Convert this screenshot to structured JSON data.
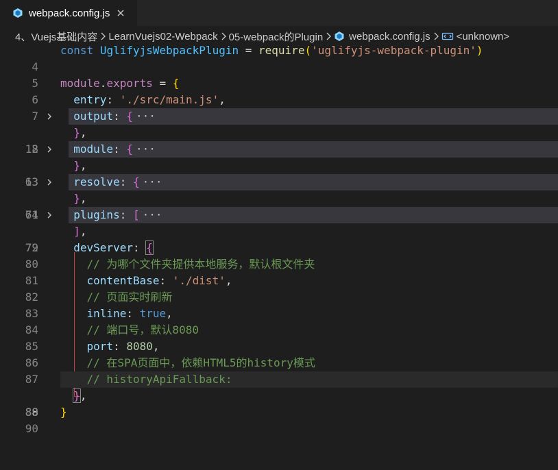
{
  "tab": {
    "label": "webpack.config.js",
    "icon": "webpack-file-icon",
    "close_icon": "close-icon"
  },
  "breadcrumb": {
    "items": [
      "4、Vuejs基础内容",
      "LearnVuejs02-Webpack",
      "05-webpack的Plugin",
      "webpack.config.js",
      "<unknown>"
    ]
  },
  "editor": {
    "line_numbers": [
      "4",
      "5",
      "6",
      "7",
      "8",
      "12",
      "13",
      "63",
      "64",
      "71",
      "72",
      "79",
      "80",
      "81",
      "82",
      "83",
      "84",
      "85",
      "86",
      "87",
      "88",
      "89",
      "90"
    ],
    "code": {
      "l4": {
        "kw_const": "const",
        "name": "UglifyjsWebpackPlugin",
        "eq": " = ",
        "fn": "require",
        "open": "(",
        "str": "'uglifyjs-webpack-plugin'",
        "close": ")"
      },
      "l6": {
        "obj": "module",
        "dot": ".",
        "prop": "exports",
        "eq": " = ",
        "open": "{"
      },
      "l7": {
        "key": "entry",
        "colon": ": ",
        "str": "'./src/main.js'",
        "comma": ","
      },
      "l8": {
        "key": "output",
        "colon": ": ",
        "open": "{",
        "ellipsis": "···"
      },
      "l12": {
        "close": "}",
        "comma": ","
      },
      "l13": {
        "key": "module",
        "colon": ": ",
        "open": "{",
        "ellipsis": "···"
      },
      "l63": {
        "close": "}",
        "comma": ","
      },
      "l64": {
        "key": "resolve",
        "colon": ": ",
        "open": "{",
        "ellipsis": "···"
      },
      "l71": {
        "close": "}",
        "comma": ","
      },
      "l72": {
        "key": "plugins",
        "colon": ": ",
        "open": "[",
        "ellipsis": "···"
      },
      "l79": {
        "close": "]",
        "comma": ","
      },
      "l80": {
        "key": "devServer",
        "colon": ": ",
        "open": "{"
      },
      "l81": {
        "comment": "// 为哪个文件夹提供本地服务，默认根文件夹"
      },
      "l82": {
        "key": "contentBase",
        "colon": ": ",
        "str": "'./dist'",
        "comma": ","
      },
      "l83": {
        "comment": "// 页面实时刷新"
      },
      "l84": {
        "key": "inline",
        "colon": ": ",
        "val": "true",
        "comma": ","
      },
      "l85": {
        "comment": "// 端口号，默认8080"
      },
      "l86": {
        "key": "port",
        "colon": ": ",
        "num": "8080",
        "comma": ","
      },
      "l87": {
        "comment": "// 在SPA页面中，依赖HTML5的history模式"
      },
      "l88": {
        "comment": "// historyApiFallback:"
      },
      "l89": {
        "close": "}",
        "comma": ","
      },
      "l90": {
        "close": "}"
      }
    }
  },
  "colors": {
    "background": "#1e1e1e",
    "tabbar": "#252526",
    "keyword": "#569cd6",
    "control": "#c586c0",
    "variable": "#9cdcfe",
    "function": "#dcdcaa",
    "string": "#ce9178",
    "number": "#b5cea8",
    "comment": "#6a9955",
    "bracket_gold": "#ffd700",
    "bracket_purple": "#da70d6",
    "bracket_blue": "#179fff"
  }
}
